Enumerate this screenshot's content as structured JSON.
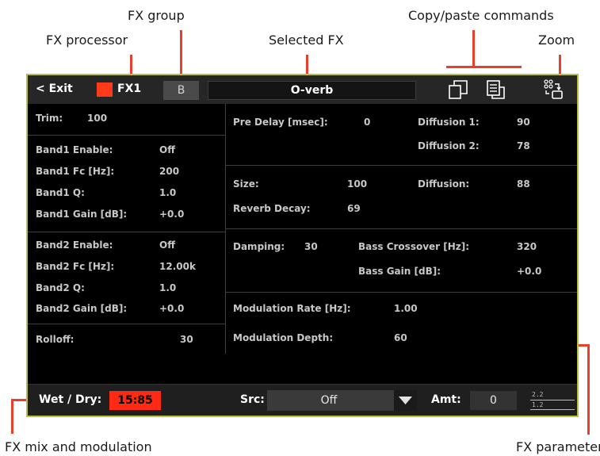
{
  "callouts": {
    "fx_group": "FX group",
    "copy_paste": "Copy/paste commands",
    "fx_processor": "FX processor",
    "selected_fx": "Selected FX",
    "zoom": "Zoom",
    "fx_mix": "FX mix and modulation",
    "fx_params": "FX parameters"
  },
  "header": {
    "exit": "< Exit",
    "fx_processor": "FX1",
    "fx_group": "B",
    "selected_fx": "O-verb",
    "icons": [
      "copy-icon",
      "paste-icon",
      "zoom-icon"
    ]
  },
  "left": {
    "trim_label": "Trim:",
    "trim_value": "100",
    "b1_enable_label": "Band1 Enable:",
    "b1_enable_value": "Off",
    "b1_fc_label": "Band1 Fc [Hz]:",
    "b1_fc_value": "200",
    "b1_q_label": "Band1 Q:",
    "b1_q_value": "1.0",
    "b1_gain_label": "Band1 Gain [dB]:",
    "b1_gain_value": "+0.0",
    "b2_enable_label": "Band2 Enable:",
    "b2_enable_value": "Off",
    "b2_fc_label": "Band2 Fc [Hz]:",
    "b2_fc_value": "12.00k",
    "b2_q_label": "Band2 Q:",
    "b2_q_value": "1.0",
    "b2_gain_label": "Band2 Gain [dB]:",
    "b2_gain_value": "+0.0",
    "rolloff_label": "Rolloff:",
    "rolloff_value": "30"
  },
  "right": {
    "predelay_label": "Pre Delay [msec]:",
    "predelay_value": "0",
    "diff1_label": "Diffusion 1:",
    "diff1_value": "90",
    "diff2_label": "Diffusion 2:",
    "diff2_value": "78",
    "size_label": "Size:",
    "size_value": "100",
    "diffusion_label": "Diffusion:",
    "diffusion_value": "88",
    "decay_label": "Reverb Decay:",
    "decay_value": "69",
    "damping_label": "Damping:",
    "damping_value": "30",
    "bass_xover_label": "Bass Crossover [Hz]:",
    "bass_xover_value": "320",
    "bass_gain_label": "Bass Gain [dB]:",
    "bass_gain_value": "+0.0",
    "mod_rate_label": "Modulation Rate [Hz]:",
    "mod_rate_value": "1.00",
    "mod_depth_label": "Modulation Depth:",
    "mod_depth_value": "60"
  },
  "bottom": {
    "wet_dry_label": "Wet / Dry:",
    "wet_dry_value": "15:85",
    "src_label": "Src:",
    "src_value": "Off",
    "amt_label": "Amt:",
    "amt_value": "0",
    "version_top": "2.2",
    "version_bottom": "1.2"
  },
  "colors": {
    "accent_red": "#ff3b1a",
    "screen_border": "#b9c23a",
    "callout_line": "#e8402a"
  }
}
